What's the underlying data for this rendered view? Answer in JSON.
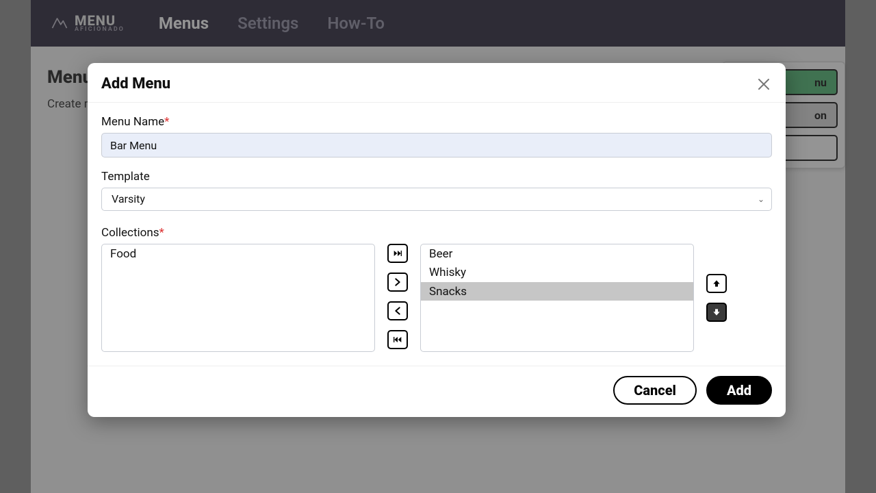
{
  "brand": {
    "line1": "MENU",
    "line2": "AFICIONADO"
  },
  "nav": {
    "menus": "Menus",
    "settings": "Settings",
    "howto": "How-To"
  },
  "page": {
    "title": "Menu",
    "subtitle": "Create m"
  },
  "side": {
    "green": "nu",
    "gray": "on",
    "white": ""
  },
  "modal": {
    "title": "Add Menu",
    "menu_name_label": "Menu Name",
    "menu_name_value": "Bar Menu",
    "template_label": "Template",
    "template_value": "Varsity",
    "collections_label": "Collections",
    "available": [
      "Food"
    ],
    "selected": [
      {
        "label": "Beer",
        "selected": false
      },
      {
        "label": "Whisky",
        "selected": false
      },
      {
        "label": "Snacks",
        "selected": true
      }
    ],
    "cancel": "Cancel",
    "add": "Add"
  }
}
